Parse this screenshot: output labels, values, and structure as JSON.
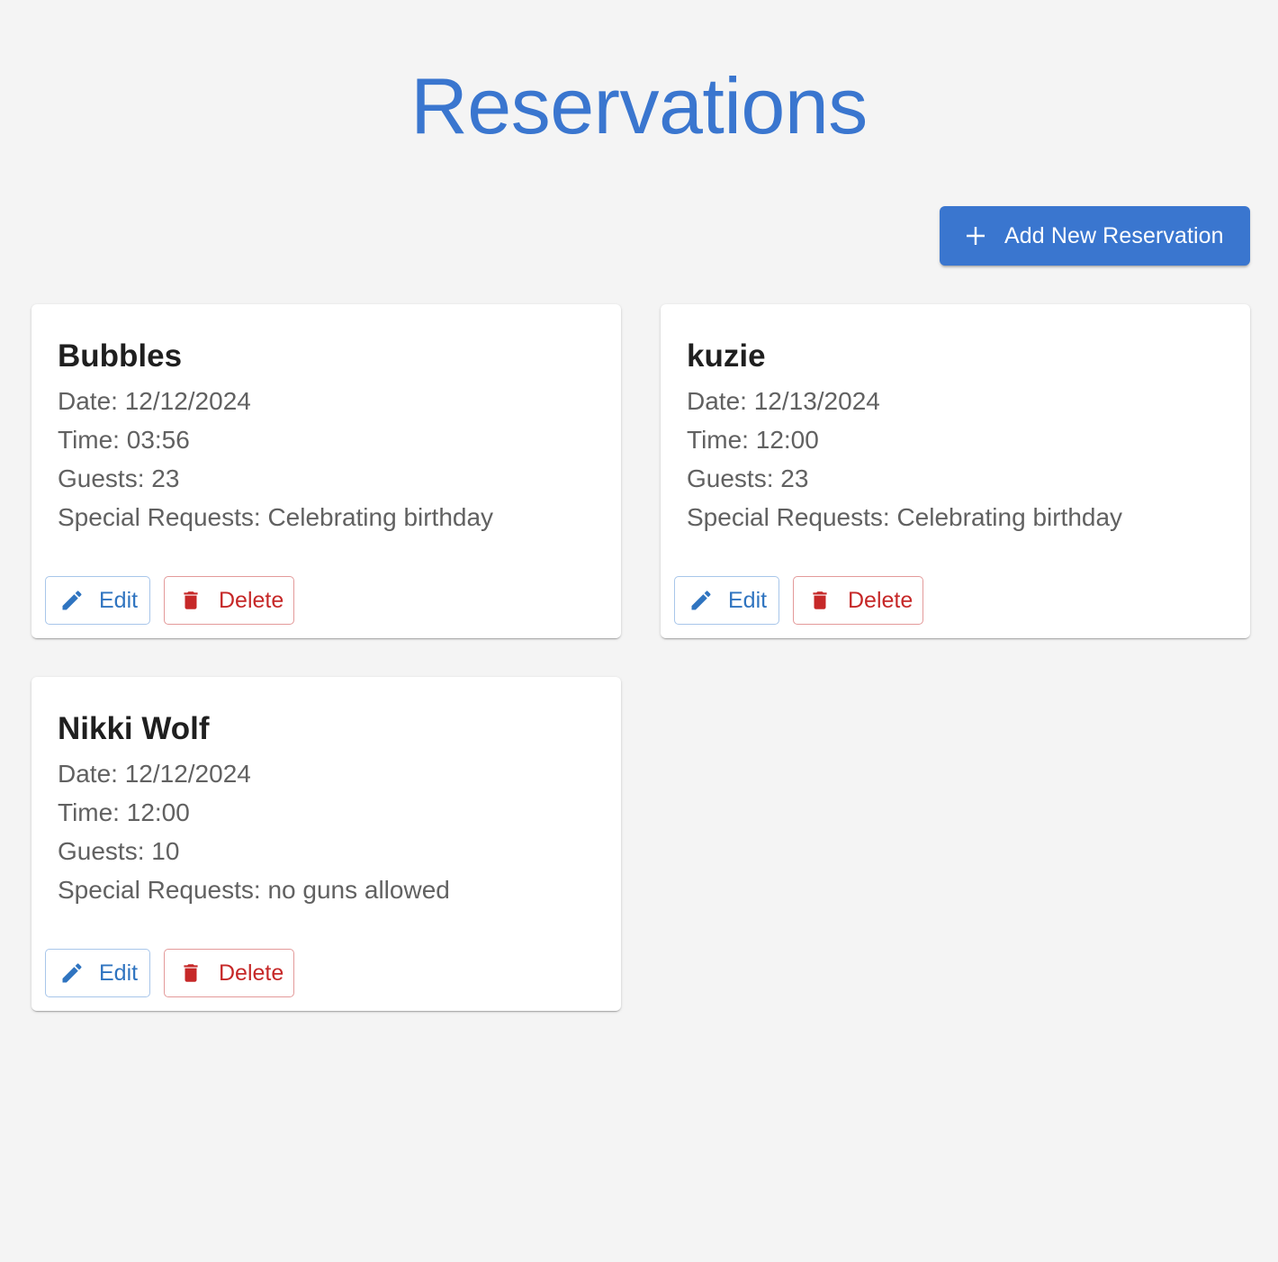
{
  "header": {
    "title": "Reservations"
  },
  "toolbar": {
    "add_label": "Add New Reservation",
    "add_icon": "plus-icon"
  },
  "colors": {
    "primary": "#3a76cf",
    "edit": "#2f74c0",
    "delete": "#c62828",
    "background": "#f4f4f4"
  },
  "reservations": [
    {
      "name": "Bubbles",
      "date": "Date: 12/12/2024",
      "time": "Time: 03:56",
      "guests": "Guests: 23",
      "requests": "Special Requests: Celebrating birthday",
      "edit_label": "Edit",
      "delete_label": "Delete"
    },
    {
      "name": "kuzie",
      "date": "Date: 12/13/2024",
      "time": "Time: 12:00",
      "guests": "Guests: 23",
      "requests": "Special Requests: Celebrating birthday",
      "edit_label": "Edit",
      "delete_label": "Delete"
    },
    {
      "name": "Nikki Wolf",
      "date": "Date: 12/12/2024",
      "time": "Time: 12:00",
      "guests": "Guests: 10",
      "requests": "Special Requests: no guns allowed",
      "edit_label": "Edit",
      "delete_label": "Delete"
    }
  ]
}
